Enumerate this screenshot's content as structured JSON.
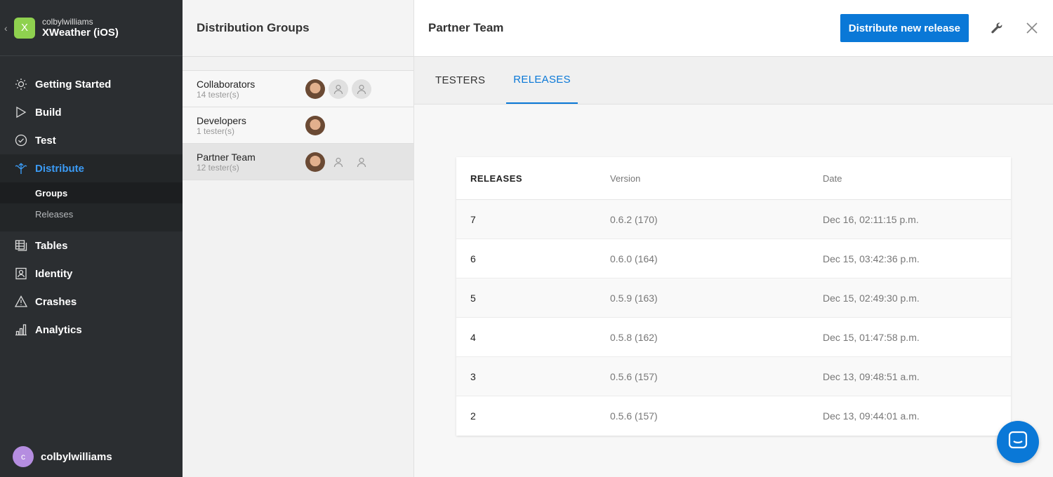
{
  "app": {
    "owner": "colbylwilliams",
    "name": "XWeather (iOS)",
    "initial": "X",
    "accent": "#8fd14f"
  },
  "nav": {
    "items": [
      {
        "label": "Getting Started",
        "icon": "sun-icon"
      },
      {
        "label": "Build",
        "icon": "play-icon"
      },
      {
        "label": "Test",
        "icon": "check-circle-icon"
      },
      {
        "label": "Distribute",
        "icon": "distribute-icon"
      },
      {
        "label": "Tables",
        "icon": "tables-icon"
      },
      {
        "label": "Identity",
        "icon": "identity-icon"
      },
      {
        "label": "Crashes",
        "icon": "warning-icon"
      },
      {
        "label": "Analytics",
        "icon": "bar-chart-icon"
      }
    ],
    "sub": [
      {
        "label": "Groups"
      },
      {
        "label": "Releases"
      }
    ]
  },
  "user": {
    "name": "colbylwilliams",
    "initial": "c"
  },
  "groups": {
    "title": "Distribution Groups",
    "items": [
      {
        "name": "Collaborators",
        "count": "14 tester(s)"
      },
      {
        "name": "Developers",
        "count": "1 tester(s)"
      },
      {
        "name": "Partner Team",
        "count": "12 tester(s)"
      }
    ]
  },
  "main": {
    "title": "Partner Team",
    "distribute_label": "Distribute new release",
    "tabs": [
      {
        "label": "TESTERS"
      },
      {
        "label": "RELEASES"
      }
    ],
    "table": {
      "headers": [
        "RELEASES",
        "Version",
        "Date"
      ],
      "rows": [
        [
          "7",
          "0.6.2 (170)",
          "Dec 16, 02:11:15 p.m."
        ],
        [
          "6",
          "0.6.0 (164)",
          "Dec 15, 03:42:36 p.m."
        ],
        [
          "5",
          "0.5.9 (163)",
          "Dec 15, 02:49:30 p.m."
        ],
        [
          "4",
          "0.5.8 (162)",
          "Dec 15, 01:47:58 p.m."
        ],
        [
          "3",
          "0.5.6 (157)",
          "Dec 13, 09:48:51 a.m."
        ],
        [
          "2",
          "0.5.6 (157)",
          "Dec 13, 09:44:01 a.m."
        ]
      ]
    }
  },
  "colors": {
    "primary": "#0a78d7",
    "sidebar": "#2b2e31"
  }
}
